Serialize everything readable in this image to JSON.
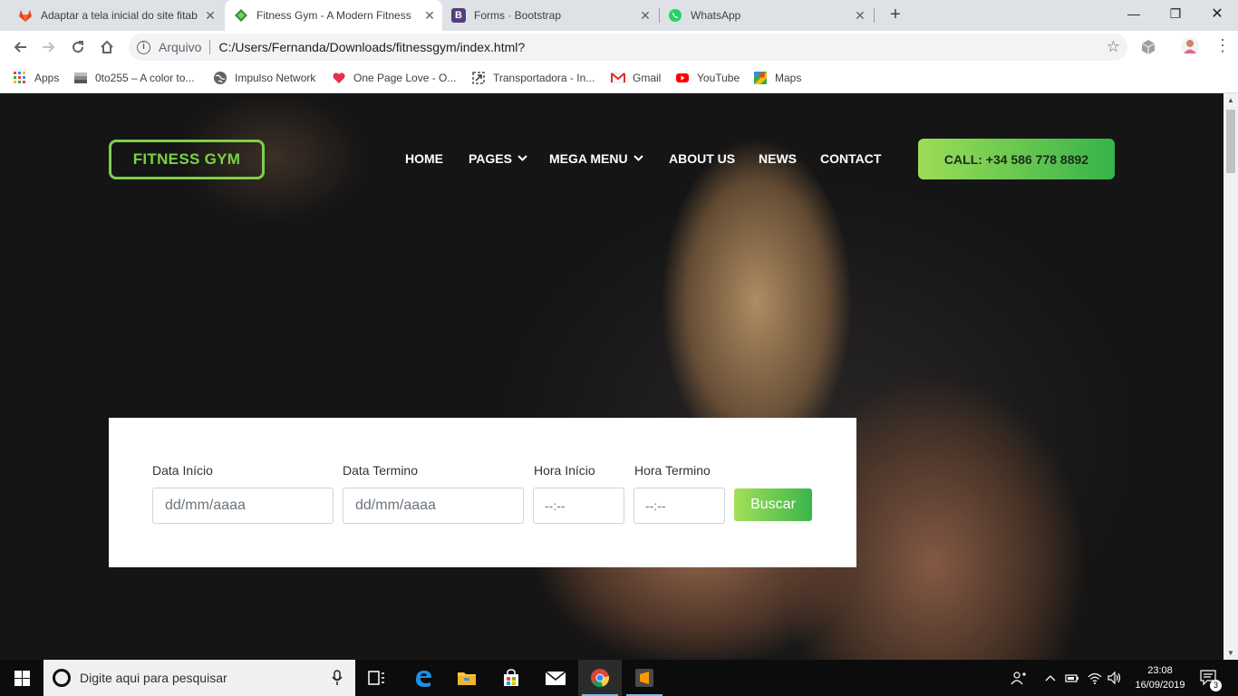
{
  "browser": {
    "tabs": [
      {
        "title": "Adaptar a tela inicial do site fitab",
        "icon": "gitlab-icon"
      },
      {
        "title": "Fitness Gym - A Modern Fitness",
        "icon": "fitness-gym-icon"
      },
      {
        "title": "Forms · Bootstrap",
        "icon": "bootstrap-icon"
      },
      {
        "title": "WhatsApp",
        "icon": "whatsapp-icon"
      }
    ],
    "omnibox": {
      "scheme": "Arquivo",
      "url": "C:/Users/Fernanda/Downloads/fitnessgym/index.html?"
    },
    "bookmarks": [
      {
        "label": "Apps",
        "icon": "apps-grid-icon"
      },
      {
        "label": "0to255 – A color to...",
        "icon": "gray-block-icon"
      },
      {
        "label": "Impulso Network",
        "icon": "globe-icon"
      },
      {
        "label": "One Page Love - O...",
        "icon": "heart-icon"
      },
      {
        "label": "Transportadora - In...",
        "icon": "arrow-box-icon"
      },
      {
        "label": "Gmail",
        "icon": "gmail-icon"
      },
      {
        "label": "YouTube",
        "icon": "youtube-icon"
      },
      {
        "label": "Maps",
        "icon": "maps-icon"
      }
    ]
  },
  "site": {
    "logo": "FITNESS GYM",
    "nav": [
      {
        "label": "HOME",
        "dropdown": false
      },
      {
        "label": "PAGES",
        "dropdown": true
      },
      {
        "label": "MEGA MENU",
        "dropdown": true
      },
      {
        "label": "ABOUT US",
        "dropdown": false
      },
      {
        "label": "NEWS",
        "dropdown": false
      },
      {
        "label": "CONTACT",
        "dropdown": false
      }
    ],
    "cta": "CALL: +34 586 778 8892",
    "accent_color": "#7ad246",
    "form": {
      "fields": [
        {
          "label": "Data Início",
          "placeholder": "dd/mm/aaaa"
        },
        {
          "label": "Data Termino",
          "placeholder": "dd/mm/aaaa"
        },
        {
          "label": "Hora Início",
          "placeholder": "--:--"
        },
        {
          "label": "Hora Termino",
          "placeholder": "--:--"
        }
      ],
      "submit": "Buscar"
    }
  },
  "taskbar": {
    "search_placeholder": "Digite aqui para pesquisar",
    "time": "23:08",
    "date": "16/09/2019",
    "notifications": "3"
  }
}
